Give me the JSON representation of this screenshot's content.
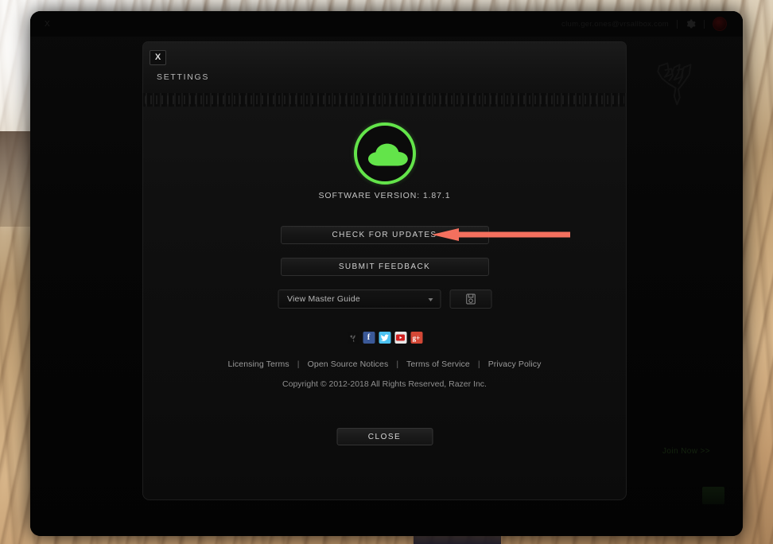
{
  "desktop": {
    "wallpaper_description": "sand-dunes-desert-photo"
  },
  "app_window": {
    "titlebar": {
      "left_label": "X",
      "account_email": "clum.ger.ones@vrsallbox.com",
      "gear_icon": "gear-icon",
      "avatar": "user-avatar"
    },
    "watermark": "razer-triple-snake-logo",
    "promo": {
      "text": "Join Now >>"
    }
  },
  "dialog": {
    "close_x": "X",
    "tab_label": "SETTINGS",
    "logo": {
      "name": "razer-synapse-cloud-logo",
      "ring_color": "#63E44A",
      "cloud_color": "#63E44A"
    },
    "version": {
      "label": "SOFTWARE VERSION:",
      "value": "1.87.1",
      "full": "SOFTWARE VERSION:  1.87.1"
    },
    "buttons": {
      "check_updates": "CHECK FOR UPDATES",
      "submit_feedback": "SUBMIT FEEDBACK",
      "close": "CLOSE"
    },
    "guide": {
      "selected": "View Master Guide",
      "options": [
        "View Master Guide"
      ],
      "download_icon": "save-document-icon"
    },
    "social": [
      {
        "name": "razer-icon",
        "glyph": "≈",
        "color": "#0D0D0D",
        "class": "si-razer"
      },
      {
        "name": "facebook-icon",
        "glyph": "f",
        "color": "#3B5998",
        "class": "si-fb"
      },
      {
        "name": "twitter-icon",
        "glyph": "ᴠ",
        "color": "#4CC2F1",
        "class": "si-tw"
      },
      {
        "name": "youtube-icon",
        "glyph": "▶",
        "color": "#E8E8E8",
        "class": "si-yt"
      },
      {
        "name": "googleplus-icon",
        "glyph": "g+",
        "color": "#D34836",
        "class": "si-gp"
      }
    ],
    "footer_links": [
      "Licensing Terms",
      "Open Source Notices",
      "Terms of Service",
      "Privacy Policy"
    ],
    "footer_separator": "|",
    "copyright": "Copyright © 2012-2018 All Rights Reserved, Razer Inc."
  },
  "annotation": {
    "arrow": {
      "name": "pointer-arrow",
      "color": "#F4705E",
      "points_to": "CHECK FOR UPDATES"
    }
  }
}
